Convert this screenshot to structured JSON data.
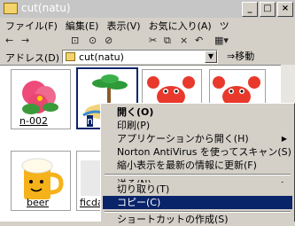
{
  "window": {
    "title": "cut(natu)",
    "controls": [
      "_",
      "□",
      "×"
    ]
  },
  "menubar": [
    "ファイル(F)",
    "編集(E)",
    "表示(V)",
    "お気に入り(A)",
    "ツ"
  ],
  "toolbar": {
    "back": "←",
    "forward": "→",
    "items": [
      "⊡",
      "⊙",
      "⊘",
      "✂",
      "⧉",
      "×",
      "↶",
      "▦▾"
    ]
  },
  "address": {
    "label": "アドレス(D)",
    "value": "cut(natu)",
    "go": "⇒移動"
  },
  "files": [
    {
      "name": "n-002",
      "icon": "hibiscus-icon"
    },
    {
      "name": "n",
      "icon": "palm-island-icon",
      "selected": true
    },
    {
      "name": "",
      "icon": "crab-icon"
    },
    {
      "name": "",
      "icon": "crab-icon"
    },
    {
      "name": "beer",
      "icon": "beer-mug-icon"
    },
    {
      "name": "ficda",
      "icon": "partial-icon"
    }
  ],
  "context_menu": {
    "items": [
      {
        "label": "開く(O)",
        "bold": true
      },
      {
        "label": "印刷(P)"
      },
      {
        "label": "アプリケーションから開く(H)",
        "submenu": true
      },
      {
        "label": "Norton AntiVirus を使ってスキャン(S)"
      },
      {
        "label": "縮小表示を最新の情報に更新(F)"
      },
      {
        "sep": true
      },
      {
        "label": "送る(N)",
        "submenu": true
      },
      {
        "sep": true
      },
      {
        "label": "切り取り(T)"
      },
      {
        "label": "コピー(C)",
        "selected": true
      },
      {
        "sep": true
      },
      {
        "label": "ショートカットの作成(S)"
      }
    ]
  }
}
